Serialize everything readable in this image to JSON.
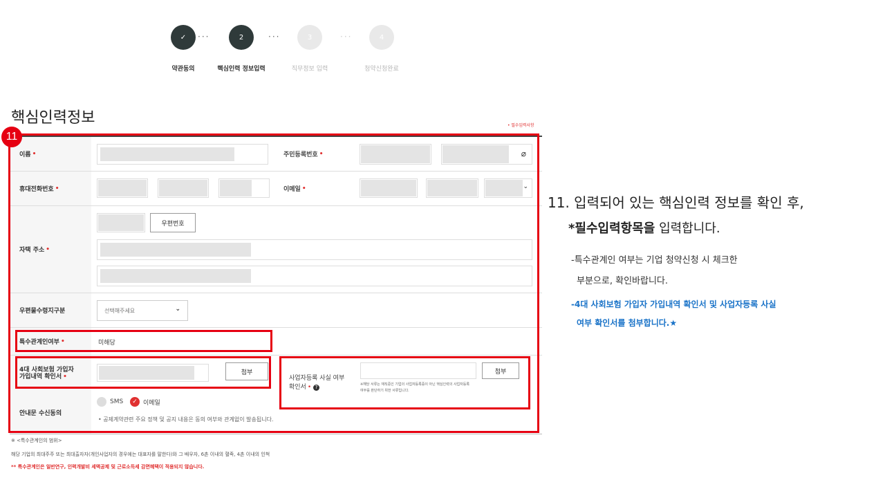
{
  "stepper": {
    "steps": [
      {
        "num": "✓",
        "label": "약관동의"
      },
      {
        "num": "2",
        "label": "핵심인력 정보입력"
      },
      {
        "num": "3",
        "label": "직무정보 입력"
      },
      {
        "num": "4",
        "label": "청약신청완료"
      }
    ]
  },
  "page_title": "핵심인력정보",
  "required_note": "• 필수입력사항",
  "required_mark": "•",
  "annotation_number": "11",
  "fields": {
    "name": "이름",
    "resident_number": "주민등록번호",
    "mobile": "휴대전화번호",
    "email": "이메일",
    "home_address": "자택 주소",
    "zip_button": "우편번호",
    "mail_receive": "우편물수령지구분",
    "mail_receive_select": "선택해주세요",
    "special_relation": "특수관계인여부",
    "special_relation_value": "미해당",
    "insurance_line1": "4대 사회보험 가입자",
    "insurance_line2": "가입내역 확인서",
    "attach_button": "첨부",
    "business_line1": "사업자등록 사실 여부",
    "business_line2": "확인서",
    "business_attach_button": "첨부",
    "business_note_line1": "※해당 서류는 재직중인 기업의 사업자등록증이 아닌 핵심인력의 사업자등록",
    "business_note_line2": "여부를 판단하기 위한 서류입니다.",
    "notice_consent": "안내문 수신동의",
    "sms": "SMS",
    "email_option": "이메일",
    "notice_text": "• 공제계약관련 주요 정책 및 공지 내용은 동의 여부와 관계없이 발송됩니다."
  },
  "footnotes": {
    "line1": "※ <특수관계인의 범위>",
    "line2": "해당 기업의 최대주주 또는 최대출자자(개인사업자의 경우에는 대표자를 말한다)와 그 배우자, 6촌 이내의 혈족, 4촌 이내의 인척",
    "line3": "** 특수관계인은 일반연구, 인력개발비 세액공제 및 근로소득세 감면혜택이 적용되지 않습니다."
  },
  "instructions": {
    "line1": "11. 입력되어 있는 핵심인력 정보를 확인 후,",
    "line2_bold": "*필수입력항목을",
    "line2_rest": " 입력합니다.",
    "line3": "-특수관계인 여부는 기업 청약신청 시 체크한",
    "line4": "부분으로, 확인바랍니다.",
    "line5": "-4대 사회보험 가입자 가입내역 확인서 및 사업자등록 사실",
    "line6": "여부 확인서를 첨부합니다.★"
  },
  "colors": {
    "highlight": "#e60012",
    "accent_blue": "#1a73c8",
    "required_red": "#e03030",
    "step_dark": "#2f3a3a"
  }
}
